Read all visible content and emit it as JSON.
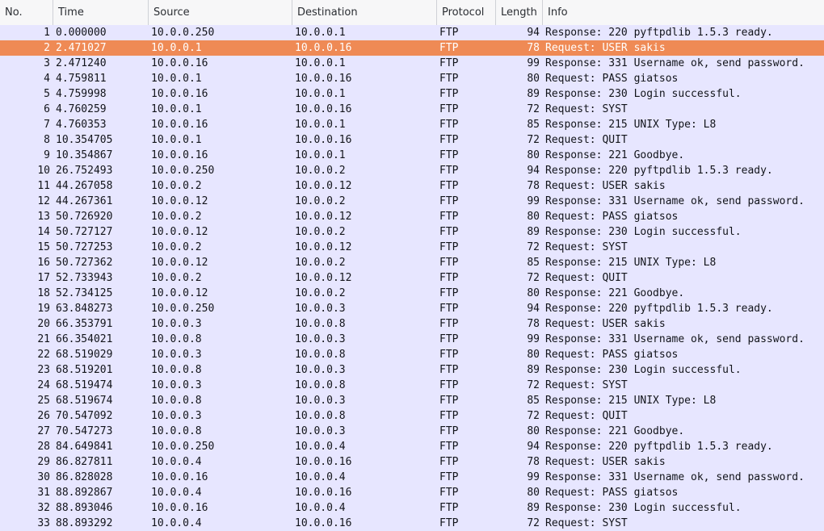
{
  "columns": {
    "no": "No.",
    "time": "Time",
    "source": "Source",
    "destination": "Destination",
    "protocol": "Protocol",
    "length": "Length",
    "info": "Info"
  },
  "selected_row": 2,
  "colors": {
    "row": "#e7e6ff",
    "selected": "#ef8a55"
  },
  "packets": [
    [
      "1",
      "0.000000",
      "10.0.0.250",
      "10.0.0.1",
      "FTP",
      "94",
      "Response: 220 pyftpdlib 1.5.3 ready."
    ],
    [
      "2",
      "2.471027",
      "10.0.0.1",
      "10.0.0.16",
      "FTP",
      "78",
      "Request: USER sakis"
    ],
    [
      "3",
      "2.471240",
      "10.0.0.16",
      "10.0.0.1",
      "FTP",
      "99",
      "Response: 331 Username ok, send password."
    ],
    [
      "4",
      "4.759811",
      "10.0.0.1",
      "10.0.0.16",
      "FTP",
      "80",
      "Request: PASS giatsos"
    ],
    [
      "5",
      "4.759998",
      "10.0.0.16",
      "10.0.0.1",
      "FTP",
      "89",
      "Response: 230 Login successful."
    ],
    [
      "6",
      "4.760259",
      "10.0.0.1",
      "10.0.0.16",
      "FTP",
      "72",
      "Request: SYST"
    ],
    [
      "7",
      "4.760353",
      "10.0.0.16",
      "10.0.0.1",
      "FTP",
      "85",
      "Response: 215 UNIX Type: L8"
    ],
    [
      "8",
      "10.354705",
      "10.0.0.1",
      "10.0.0.16",
      "FTP",
      "72",
      "Request: QUIT"
    ],
    [
      "9",
      "10.354867",
      "10.0.0.16",
      "10.0.0.1",
      "FTP",
      "80",
      "Response: 221 Goodbye."
    ],
    [
      "10",
      "26.752493",
      "10.0.0.250",
      "10.0.0.2",
      "FTP",
      "94",
      "Response: 220 pyftpdlib 1.5.3 ready."
    ],
    [
      "11",
      "44.267058",
      "10.0.0.2",
      "10.0.0.12",
      "FTP",
      "78",
      "Request: USER sakis"
    ],
    [
      "12",
      "44.267361",
      "10.0.0.12",
      "10.0.0.2",
      "FTP",
      "99",
      "Response: 331 Username ok, send password."
    ],
    [
      "13",
      "50.726920",
      "10.0.0.2",
      "10.0.0.12",
      "FTP",
      "80",
      "Request: PASS giatsos"
    ],
    [
      "14",
      "50.727127",
      "10.0.0.12",
      "10.0.0.2",
      "FTP",
      "89",
      "Response: 230 Login successful."
    ],
    [
      "15",
      "50.727253",
      "10.0.0.2",
      "10.0.0.12",
      "FTP",
      "72",
      "Request: SYST"
    ],
    [
      "16",
      "50.727362",
      "10.0.0.12",
      "10.0.0.2",
      "FTP",
      "85",
      "Response: 215 UNIX Type: L8"
    ],
    [
      "17",
      "52.733943",
      "10.0.0.2",
      "10.0.0.12",
      "FTP",
      "72",
      "Request: QUIT"
    ],
    [
      "18",
      "52.734125",
      "10.0.0.12",
      "10.0.0.2",
      "FTP",
      "80",
      "Response: 221 Goodbye."
    ],
    [
      "19",
      "63.848273",
      "10.0.0.250",
      "10.0.0.3",
      "FTP",
      "94",
      "Response: 220 pyftpdlib 1.5.3 ready."
    ],
    [
      "20",
      "66.353791",
      "10.0.0.3",
      "10.0.0.8",
      "FTP",
      "78",
      "Request: USER sakis"
    ],
    [
      "21",
      "66.354021",
      "10.0.0.8",
      "10.0.0.3",
      "FTP",
      "99",
      "Response: 331 Username ok, send password."
    ],
    [
      "22",
      "68.519029",
      "10.0.0.3",
      "10.0.0.8",
      "FTP",
      "80",
      "Request: PASS giatsos"
    ],
    [
      "23",
      "68.519201",
      "10.0.0.8",
      "10.0.0.3",
      "FTP",
      "89",
      "Response: 230 Login successful."
    ],
    [
      "24",
      "68.519474",
      "10.0.0.3",
      "10.0.0.8",
      "FTP",
      "72",
      "Request: SYST"
    ],
    [
      "25",
      "68.519674",
      "10.0.0.8",
      "10.0.0.3",
      "FTP",
      "85",
      "Response: 215 UNIX Type: L8"
    ],
    [
      "26",
      "70.547092",
      "10.0.0.3",
      "10.0.0.8",
      "FTP",
      "72",
      "Request: QUIT"
    ],
    [
      "27",
      "70.547273",
      "10.0.0.8",
      "10.0.0.3",
      "FTP",
      "80",
      "Response: 221 Goodbye."
    ],
    [
      "28",
      "84.649841",
      "10.0.0.250",
      "10.0.0.4",
      "FTP",
      "94",
      "Response: 220 pyftpdlib 1.5.3 ready."
    ],
    [
      "29",
      "86.827811",
      "10.0.0.4",
      "10.0.0.16",
      "FTP",
      "78",
      "Request: USER sakis"
    ],
    [
      "30",
      "86.828028",
      "10.0.0.16",
      "10.0.0.4",
      "FTP",
      "99",
      "Response: 331 Username ok, send password."
    ],
    [
      "31",
      "88.892867",
      "10.0.0.4",
      "10.0.0.16",
      "FTP",
      "80",
      "Request: PASS giatsos"
    ],
    [
      "32",
      "88.893046",
      "10.0.0.16",
      "10.0.0.4",
      "FTP",
      "89",
      "Response: 230 Login successful."
    ],
    [
      "33",
      "88.893292",
      "10.0.0.4",
      "10.0.0.16",
      "FTP",
      "72",
      "Request: SYST"
    ]
  ]
}
